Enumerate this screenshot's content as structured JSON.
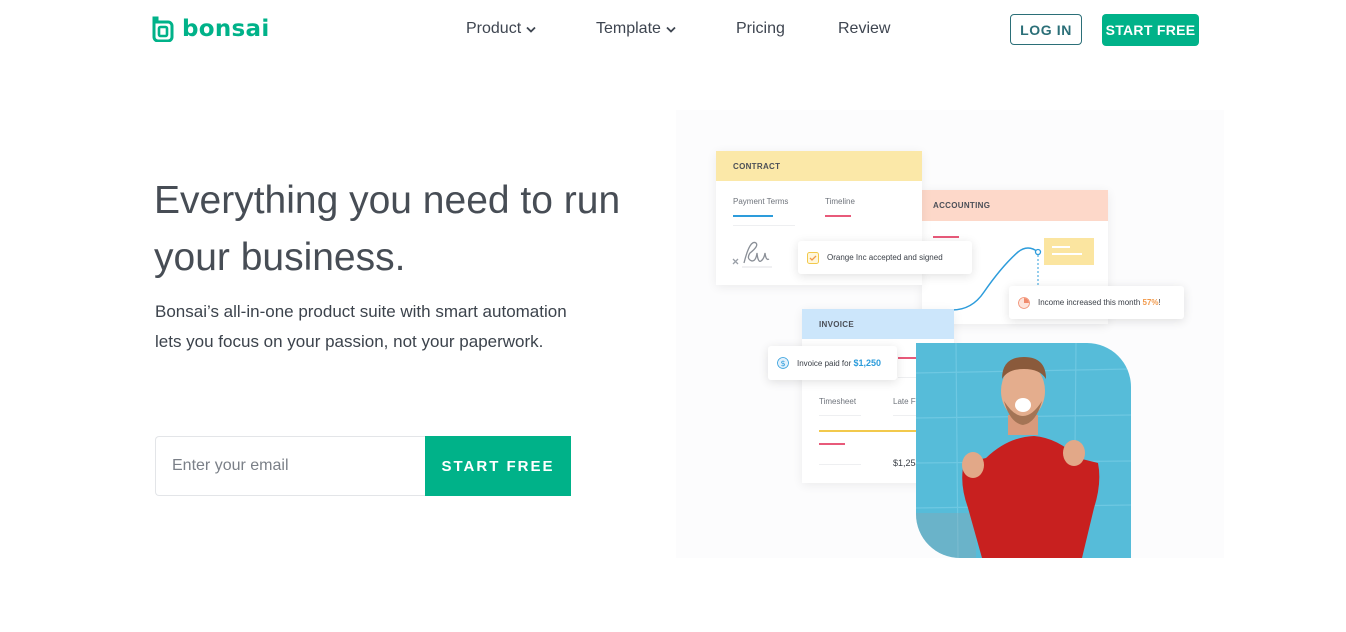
{
  "brand": {
    "name": "bonsai",
    "color": "#00b289"
  },
  "nav": {
    "items": [
      {
        "label": "Product",
        "has_dropdown": true
      },
      {
        "label": "Template",
        "has_dropdown": true
      },
      {
        "label": "Pricing",
        "has_dropdown": false
      },
      {
        "label": "Review",
        "has_dropdown": false
      }
    ],
    "login_label": "LOG IN",
    "start_label": "START FREE"
  },
  "hero": {
    "title": "Everything you need to run your business.",
    "subtitle": "Bonsai’s all-in-one product suite with smart automation lets you focus on your passion, not your paperwork.",
    "email_placeholder": "Enter your email",
    "cta_label": "START FREE"
  },
  "illustration": {
    "contract": {
      "title": "CONTRACT",
      "col1": "Payment Terms",
      "col2": "Timeline"
    },
    "accounting": {
      "title": "ACCOUNTING"
    },
    "invoice": {
      "title": "INVOICE",
      "col1": "Timesheet",
      "col2": "Late Fees",
      "total": "$1,254.00"
    },
    "toast_contract": "Orange Inc accepted and signed",
    "toast_income_prefix": "Income increased this month",
    "toast_income_pct": "57%",
    "toast_income_suffix": "!",
    "toast_invoice_prefix": "Invoice paid for",
    "toast_invoice_amount": "$1,250",
    "colors": {
      "contract": "#fbe8a8",
      "accounting": "#fdd8c9",
      "invoice": "#cce6fb",
      "accent_blue": "#2d9cdb",
      "accent_pink": "#e85a7a",
      "accent_orange": "#f2994a"
    }
  },
  "icons": [
    "bonsai-logo-icon",
    "chevron-down-icon",
    "checkbox-icon",
    "signature-icon",
    "pie-chart-icon",
    "dollar-icon"
  ]
}
